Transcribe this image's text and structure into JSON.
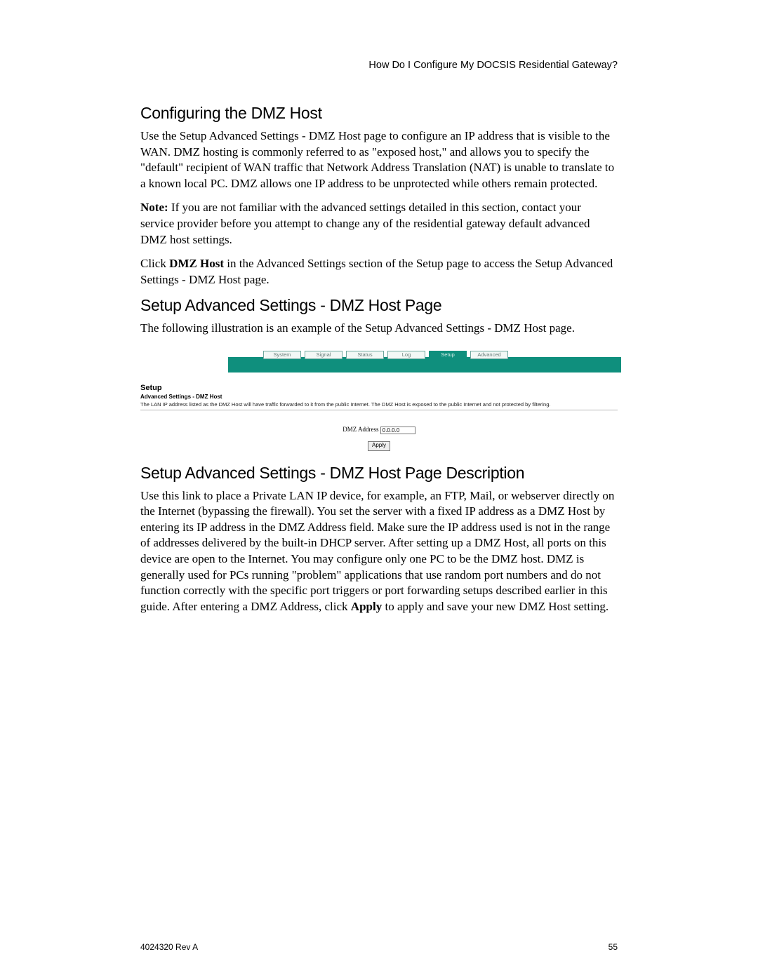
{
  "header": {
    "running_title": "How Do I Configure My DOCSIS Residential Gateway?"
  },
  "section1": {
    "title": "Configuring the DMZ Host",
    "p1": "Use the Setup Advanced Settings - DMZ Host page to configure an IP address that is visible to the WAN. DMZ hosting is commonly referred to as \"exposed host,\" and allows you to specify the \"default\" recipient of WAN traffic that Network Address Translation (NAT) is unable to translate to a known local PC. DMZ allows one IP address to be unprotected while others remain protected.",
    "p2_prefix_bold": "Note:",
    "p2_rest": " If you are not familiar with the advanced settings detailed in this section, contact your service provider before you attempt to change any of the residential gateway default advanced DMZ host settings.",
    "p3_a": "Click ",
    "p3_bold": "DMZ Host",
    "p3_b": " in the Advanced Settings section of the Setup page to access the Setup Advanced Settings - DMZ Host page."
  },
  "section2": {
    "title": "Setup Advanced Settings - DMZ Host Page",
    "p1": "The following illustration is an example of the Setup Advanced Settings - DMZ Host page."
  },
  "router": {
    "tabs": [
      "System",
      "Signal",
      "Status",
      "Log",
      "Setup",
      "Advanced"
    ],
    "active_tab_index": 4,
    "panel_title": "Setup",
    "panel_sub": "Advanced Settings - DMZ Host",
    "panel_desc": "The LAN IP address listed as the DMZ Host will have traffic forwarded to it from the public Internet. The DMZ Host is exposed to the public Internet and not protected by filtering.",
    "field_label": "DMZ Address",
    "field_value": "0.0.0.0",
    "apply_label": "Apply"
  },
  "section3": {
    "title": "Setup Advanced Settings - DMZ Host Page Description",
    "p1_a": "Use this link to place a Private LAN IP device, for example, an FTP, Mail, or webserver directly on the Internet (bypassing the firewall). You set the server with a fixed IP address as a DMZ Host by entering its IP address in the DMZ Address field. Make sure the IP address used is not in the range of addresses delivered by the built-in DHCP server. After setting up a DMZ Host, all ports on this device are open to the Internet. You may configure only one PC to be the DMZ host. DMZ is generally used for PCs running \"problem\" applications that use random port numbers and do not function correctly with the specific port triggers or port forwarding setups described earlier in this guide. After entering a DMZ Address, click ",
    "p1_bold": "Apply",
    "p1_b": " to apply and save your new DMZ Host setting."
  },
  "footer": {
    "left": "4024320 Rev A",
    "right": "55"
  }
}
